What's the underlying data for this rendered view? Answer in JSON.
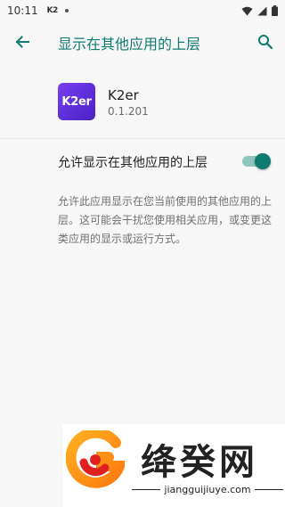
{
  "status_bar": {
    "time": "10:11",
    "app_badge": "K2"
  },
  "app_bar": {
    "title": "显示在其他应用的上层"
  },
  "app": {
    "icon_text": "K2er",
    "name": "K2er",
    "version": "0.1.201"
  },
  "setting": {
    "label": "允许显示在其他应用的上层",
    "enabled": true
  },
  "description": "允许此应用显示在您当前使用的其他应用的上层。这可能会干扰您使用相关应用，或变更这类应用的显示或运行方式。",
  "watermark": {
    "brand": "绛癸网",
    "url": "jiangguijiuye.com"
  },
  "colors": {
    "accent": "#0f7a70",
    "app_icon": "#6a35e8"
  }
}
